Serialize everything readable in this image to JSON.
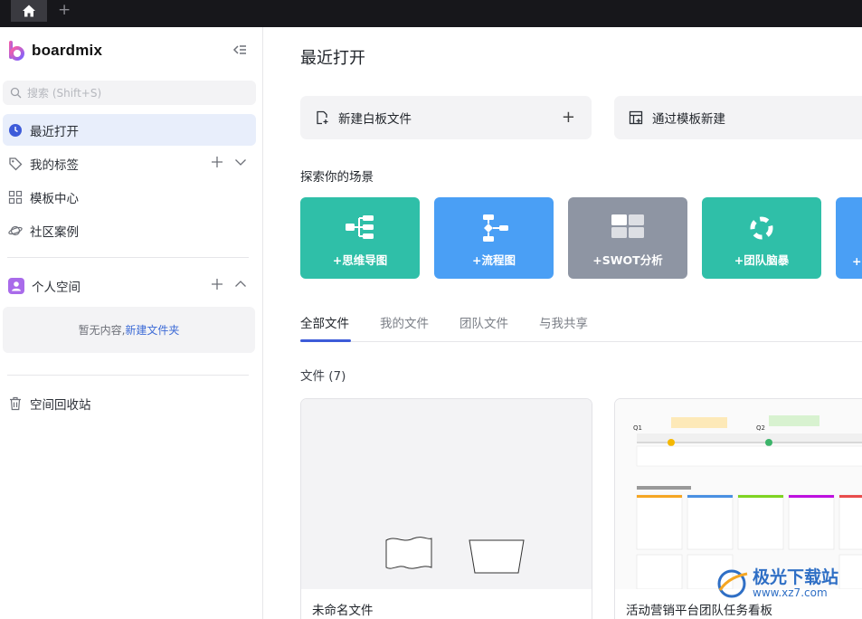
{
  "topbar": {
    "home_icon": "home-icon",
    "new_tab": "+"
  },
  "sidebar": {
    "logo_text": "boardmix",
    "search_placeholder": "搜索 (Shift+S)",
    "nav": [
      {
        "label": "最近打开",
        "icon": "clock-icon"
      },
      {
        "label": "我的标签",
        "icon": "tag-icon"
      },
      {
        "label": "模板中心",
        "icon": "grid-icon"
      },
      {
        "label": "社区案例",
        "icon": "planet-icon"
      }
    ],
    "personal_space": "个人空间",
    "empty_text": "暂无内容,",
    "empty_link": "新建文件夹",
    "trash": "空间回收站"
  },
  "main": {
    "title": "最近打开",
    "actions": [
      {
        "label": "新建白板文件",
        "plus": "+"
      },
      {
        "label": "通过模板新建"
      }
    ],
    "explore_title": "探索你的场景",
    "scenes": [
      {
        "label": "+思维导图",
        "color": "#2fbfa8"
      },
      {
        "label": "+流程图",
        "color": "#4a9ff5"
      },
      {
        "label": "+SWOT分析",
        "color": "#8e95a3"
      },
      {
        "label": "+团队脑暴",
        "color": "#2fbfa8"
      },
      {
        "label": "+",
        "color": "#4a9ff5"
      }
    ],
    "tabs": [
      "全部文件",
      "我的文件",
      "团队文件",
      "与我共享"
    ],
    "files_label": "文件 (7)",
    "files": [
      {
        "name": "未命名文件"
      },
      {
        "name": "活动营销平台团队任务看板"
      }
    ]
  },
  "watermark": {
    "text": "极光下载站",
    "url": "www.xz7.com"
  }
}
